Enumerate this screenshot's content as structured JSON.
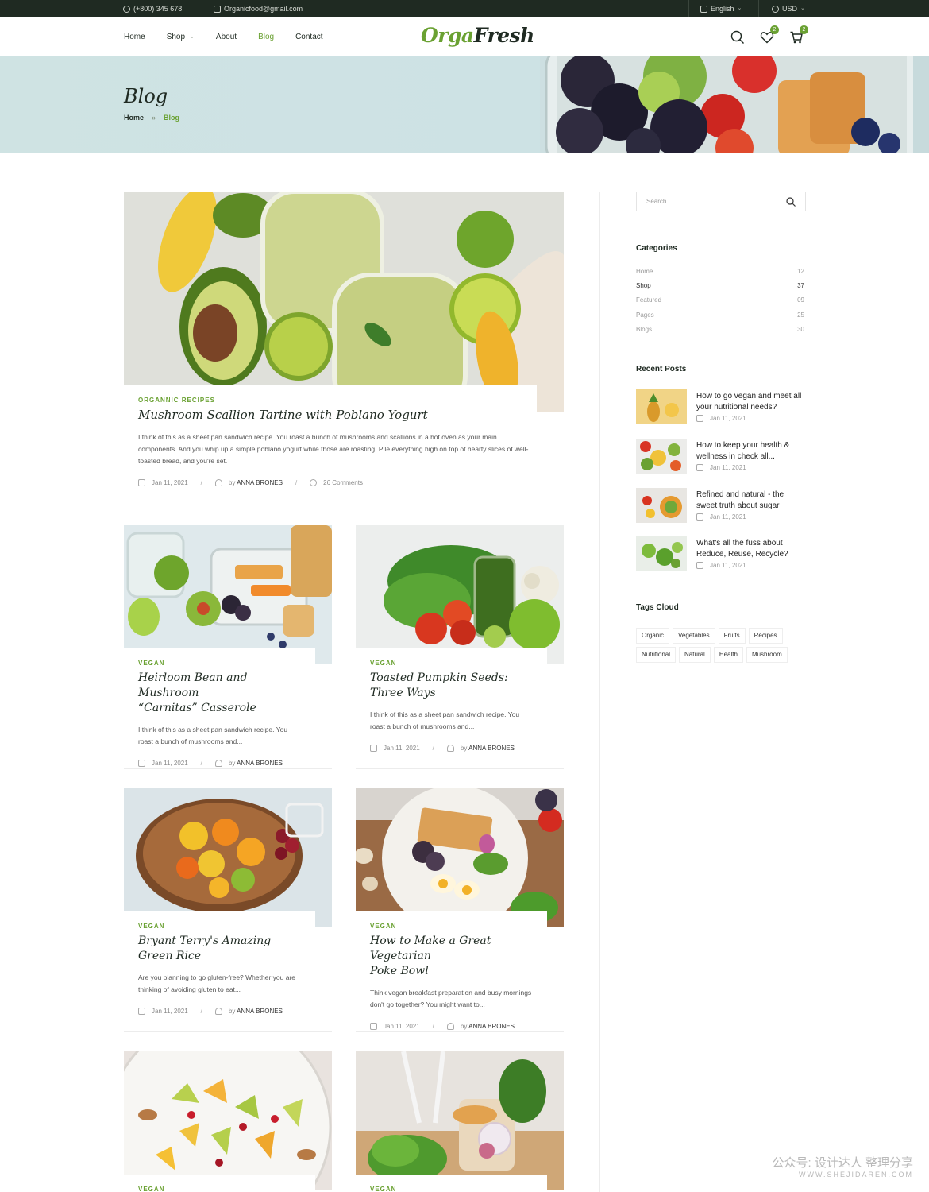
{
  "topbar": {
    "phone": "(+800) 345 678",
    "email": "Organicfood@gmail.com",
    "language": "English",
    "currency": "USD"
  },
  "nav": {
    "home": "Home",
    "shop": "Shop",
    "about": "About",
    "blog": "Blog",
    "contact": "Contact"
  },
  "logo": {
    "part1": "Orga",
    "part2": "Fresh"
  },
  "header": {
    "wishlist_count": "2",
    "cart_count": "2"
  },
  "hero": {
    "title": "Blog",
    "crumb_home": "Home",
    "crumb_sep": "»",
    "crumb_current": "Blog"
  },
  "featured": {
    "category": "ORGANNIC RECIPES",
    "title": "Mushroom Scallion Tartine with Poblano Yogurt",
    "excerpt": "I think of this as a sheet pan sandwich recipe. You roast a bunch of mushrooms and scallions in a hot oven as your main components. And you whip up a simple poblano yogurt while those are roasting. Pile everything high on top of hearty slices of well-toasted bread, and you're set.",
    "date": "Jan 11, 2021",
    "author_prefix": "by",
    "author": "ANNA BRONES",
    "comments": "26 Comments"
  },
  "posts": [
    {
      "category": "VEGAN",
      "title_1": "Heirloom Bean and Mushroom",
      "title_2": "“Carnitas” Casserole",
      "excerpt": "I think of this as a sheet pan sandwich recipe. You roast a bunch of mushrooms and...",
      "date": "Jan 11, 2021",
      "author_prefix": "by",
      "author": "ANNA BRONES"
    },
    {
      "category": "VEGAN",
      "title_1": "Toasted Pumpkin Seeds:",
      "title_2": "Three Ways",
      "excerpt": "I think of this as a sheet pan sandwich recipe. You roast a bunch of mushrooms and...",
      "date": "Jan 11, 2021",
      "author_prefix": "by",
      "author": "ANNA BRONES"
    },
    {
      "category": "VEGAN",
      "title_1": "Bryant Terry's Amazing",
      "title_2": "Green Rice",
      "excerpt": "Are you planning to go gluten-free? Whether you are thinking of avoiding gluten to eat...",
      "date": "Jan 11, 2021",
      "author_prefix": "by",
      "author": "ANNA BRONES"
    },
    {
      "category": "VEGAN",
      "title_1": "How to Make a Great Vegetarian",
      "title_2": "Poke Bowl",
      "excerpt": "Think vegan breakfast preparation and busy mornings don't go together? You might want to...",
      "date": "Jan 11, 2021",
      "author_prefix": "by",
      "author": "ANNA BRONES"
    },
    {
      "category": "VEGAN"
    },
    {
      "category": "VEGAN"
    }
  ],
  "sidebar": {
    "search_placeholder": "Search",
    "categories_title": "Categories",
    "categories": [
      {
        "name": "Home",
        "count": "12"
      },
      {
        "name": "Shop",
        "count": "37"
      },
      {
        "name": "Featured",
        "count": "09"
      },
      {
        "name": "Pages",
        "count": "25"
      },
      {
        "name": "Blogs",
        "count": "30"
      }
    ],
    "recent_title": "Recent Posts",
    "recent": [
      {
        "title": "How to go vegan and meet all your nutritional needs?",
        "date": "Jan 11, 2021"
      },
      {
        "title": "How to keep your health & wellness in check all...",
        "date": "Jan 11, 2021"
      },
      {
        "title": "Refined and natural - the sweet truth about sugar",
        "date": "Jan 11, 2021"
      },
      {
        "title": "What's all the fuss about Reduce, Reuse, Recycle?",
        "date": "Jan 11, 2021"
      }
    ],
    "tags_title": "Tags Cloud",
    "tags": [
      "Organic",
      "Vegetables",
      "Fruits",
      "Recipes",
      "Nutritional",
      "Natural",
      "Health",
      "Mushroom"
    ]
  },
  "watermark": {
    "line1": "公众号: 设计达人 整理分享",
    "line2": "WWW.SHEJIDAREN.COM"
  },
  "colors": {
    "accent": "#6aa132",
    "dark": "#1f2a22"
  }
}
